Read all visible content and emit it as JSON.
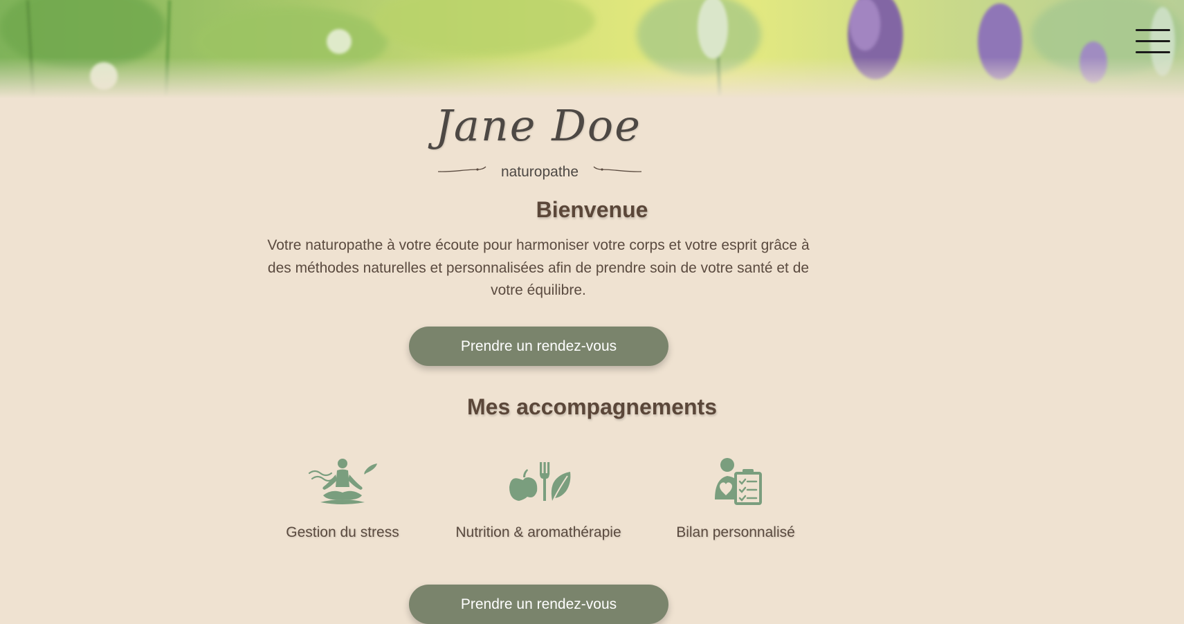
{
  "hero": {
    "menu_icon": "hamburger-menu-icon"
  },
  "brand": {
    "name": "Jane Doe",
    "tagline": "naturopathe"
  },
  "welcome": {
    "title": "Bienvenue",
    "text": "Votre naturopathe à votre écoute pour harmoniser votre corps et votre esprit grâce à des méthodes naturelles et personnalisées afin de prendre soin de votre santé et de votre équilibre."
  },
  "cta": {
    "label": "Prendre un rendez-vous"
  },
  "services": {
    "title": "Mes accompagnements",
    "items": [
      {
        "label": "Gestion du stress",
        "icon": "meditation-icon"
      },
      {
        "label": "Nutrition & aromathérapie",
        "icon": "nutrition-icon"
      },
      {
        "label": "Bilan personnalisé",
        "icon": "checkup-clipboard-icon"
      }
    ]
  },
  "colors": {
    "background": "#efe2d1",
    "accent": "#7a846c",
    "heading": "#5b4739",
    "icon": "#7a9e7e"
  }
}
